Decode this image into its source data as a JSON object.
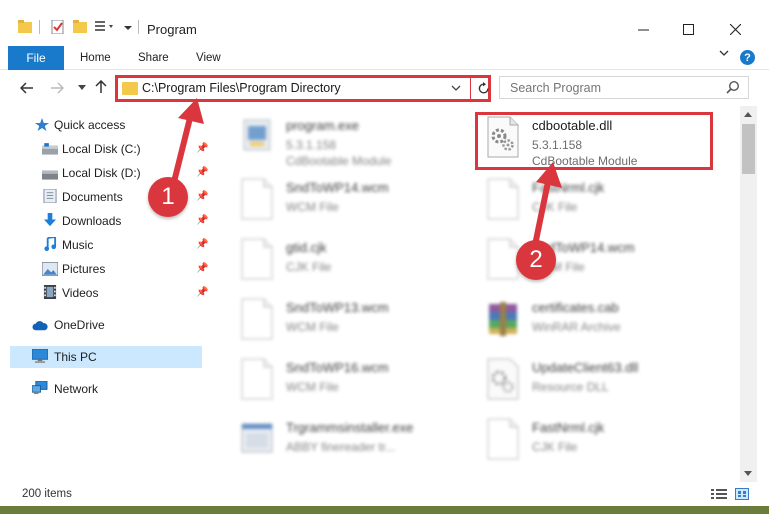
{
  "window": {
    "title": "Program"
  },
  "ribbon": {
    "tabs": [
      "File",
      "Home",
      "Share",
      "View"
    ],
    "help": "?"
  },
  "address": {
    "path": "C:\\Program Files\\Program Directory",
    "search_placeholder": "Search Program"
  },
  "sidebar": {
    "quick_access": "Quick access",
    "items": [
      {
        "label": "Local Disk (C:)",
        "icon": "drive-icon",
        "pinned": true
      },
      {
        "label": "Local Disk (D:)",
        "icon": "drive-icon",
        "pinned": true
      },
      {
        "label": "Documents",
        "icon": "documents-icon",
        "pinned": true
      },
      {
        "label": "Downloads",
        "icon": "downloads-icon",
        "pinned": true
      },
      {
        "label": "Music",
        "icon": "music-icon",
        "pinned": true
      },
      {
        "label": "Pictures",
        "icon": "pictures-icon",
        "pinned": true
      },
      {
        "label": "Videos",
        "icon": "videos-icon",
        "pinned": true
      }
    ],
    "onedrive": "OneDrive",
    "this_pc": "This PC",
    "network": "Network"
  },
  "files": [
    {
      "name": "program.exe",
      "sub1": "5.3.1.158",
      "sub2": "CdBootable Module",
      "blurred": true
    },
    {
      "name": "cdbootable.dll",
      "sub1": "5.3.1.158",
      "sub2": "CdBootable Module",
      "blurred": false
    },
    {
      "name": "SndToWP14.wcm",
      "sub1": "WCM File",
      "blurred": true
    },
    {
      "name": "FastNrml.cjk",
      "sub1": "CJK File",
      "blurred": true
    },
    {
      "name": "gtid.cjk",
      "sub1": "CJK File",
      "blurred": true
    },
    {
      "name": "SndToWP14.wcm",
      "sub1": "WCM File",
      "blurred": true
    },
    {
      "name": "SndToWP13.wcm",
      "sub1": "WCM File",
      "blurred": true
    },
    {
      "name": "certificates.cab",
      "sub1": "WinRAR Archive",
      "blurred": true
    },
    {
      "name": "SndToWP16.wcm",
      "sub1": "WCM File",
      "blurred": true
    },
    {
      "name": "UpdateClient63.dll",
      "sub1": "Resource DLL",
      "blurred": true
    },
    {
      "name": "Trgrammsinstaller.exe",
      "sub1": "ABBY finereader tr...",
      "blurred": true
    },
    {
      "name": "FastNrml.cjk",
      "sub1": "CJK File",
      "blurred": true
    }
  ],
  "status": {
    "count": "200 items"
  },
  "annotations": {
    "badge1": "1",
    "badge2": "2",
    "color": "#d9373d"
  },
  "colors": {
    "accent": "#1979ca",
    "selected": "#cce8ff",
    "highlight": "#d9373d"
  }
}
